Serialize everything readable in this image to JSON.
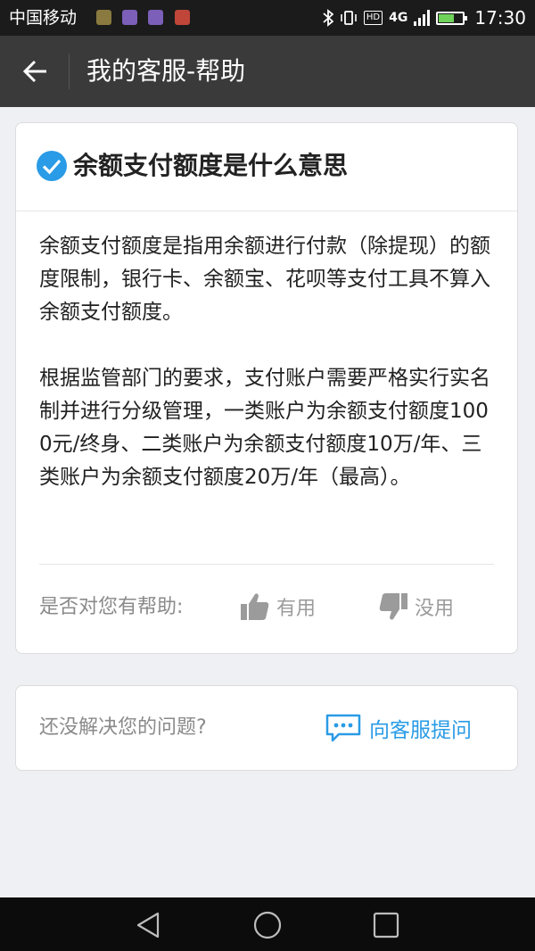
{
  "status_bar": {
    "carrier": "中国移动",
    "hd": "HD",
    "network": "4G",
    "time": "17:30",
    "battery_level": 0.6
  },
  "nav": {
    "title": "我的客服-帮助"
  },
  "article": {
    "title": "余额支付额度是什么意思",
    "body": "余额支付额度是指用余额进行付款（除提现）的额度限制，银行卡、余额宝、花呗等支付工具不算入余额支付额度。\n\n根据监管部门的要求，支付账户需要严格实行实名制并进行分级管理，一类账户为余额支付额度1000元/终身、二类账户为余额支付额度10万/年、三类账户为余额支付额度20万/年（最高）。",
    "helpful_label": "是否对您有帮助:",
    "useful_label": "有用",
    "useless_label": "没用"
  },
  "contact": {
    "label": "还没解决您的问题?",
    "button_label": "向客服提问"
  },
  "colors": {
    "accent": "#2a9be6",
    "nav_bg": "#3a3a3a",
    "page_bg": "#eff0f4"
  }
}
